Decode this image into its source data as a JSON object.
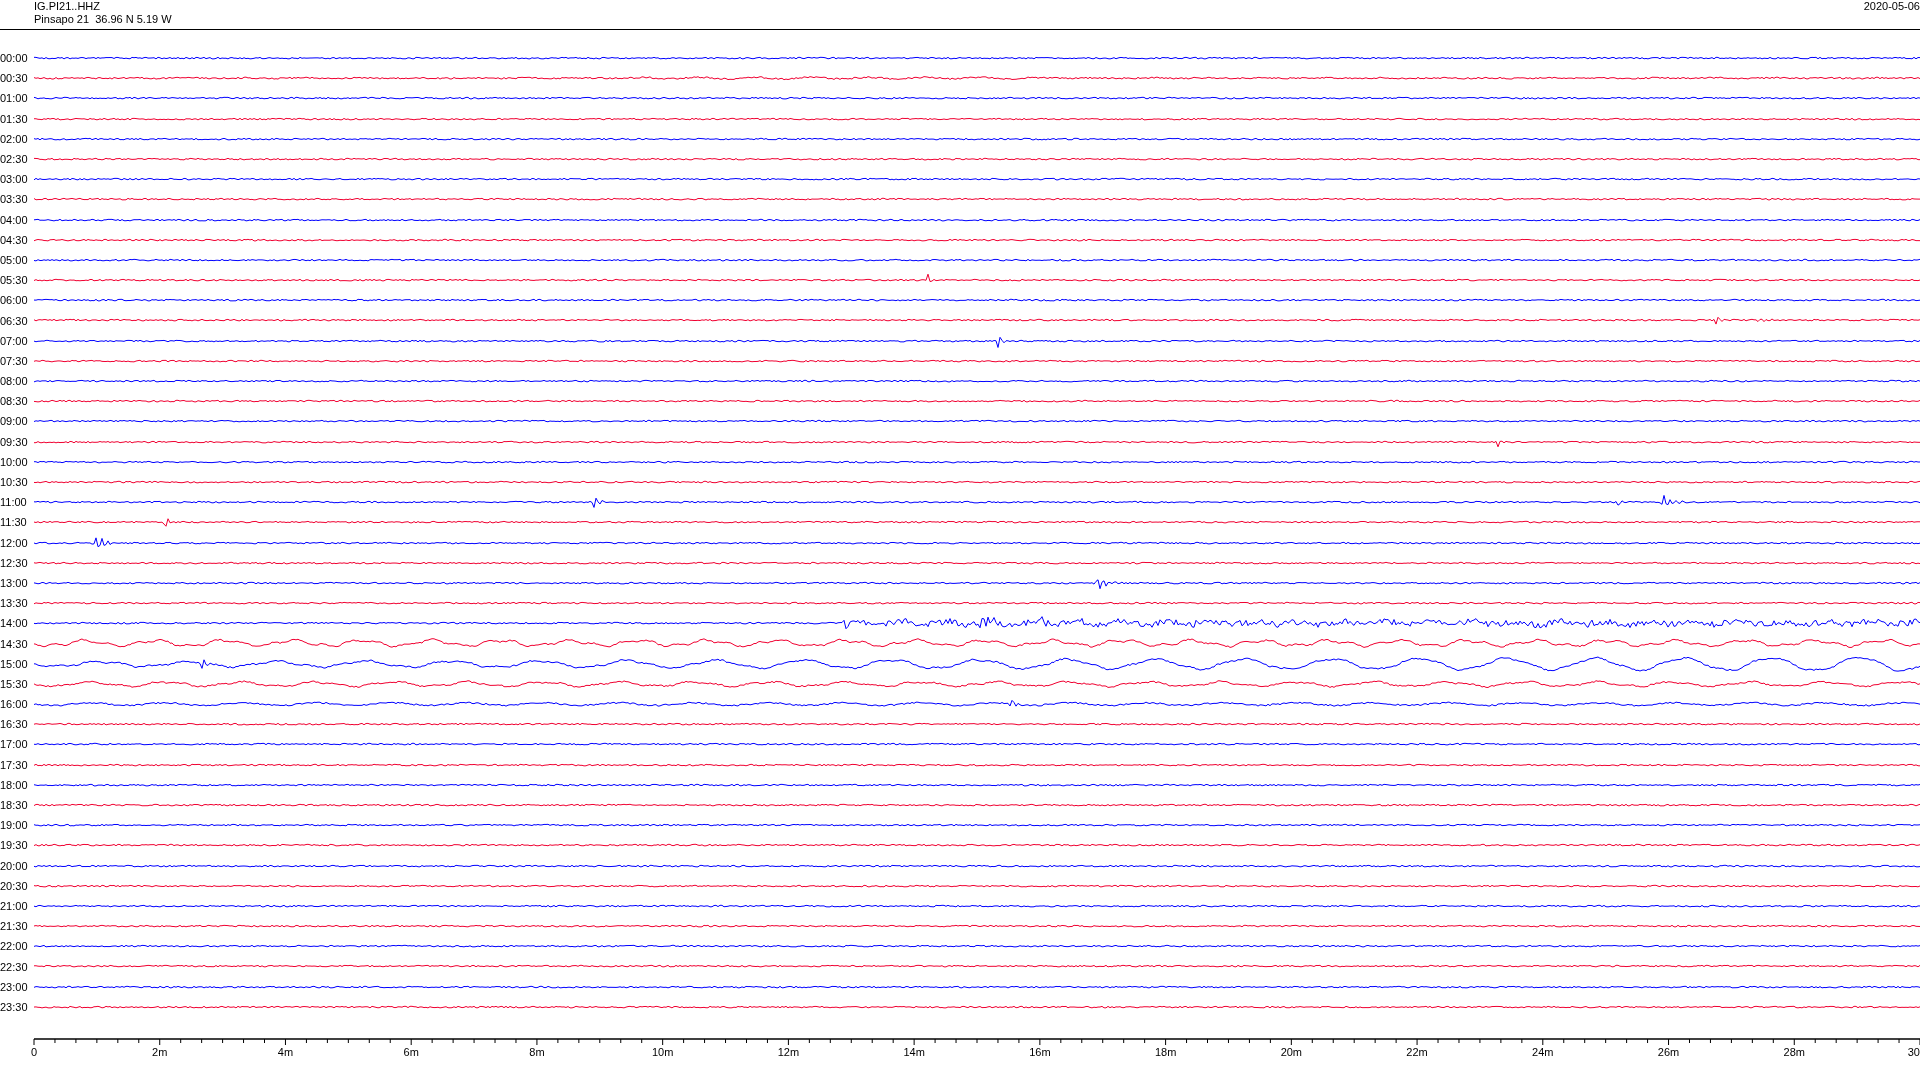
{
  "header": {
    "station": "IG.PI21..HHZ",
    "location": "Pinsapo 21  36.96 N 5.19 W",
    "date": "2020-05-06"
  },
  "traces": [
    {
      "time": "00:00",
      "color": "#0000ff"
    },
    {
      "time": "00:30",
      "color": "#f00030"
    },
    {
      "time": "01:00",
      "color": "#0000ff"
    },
    {
      "time": "01:30",
      "color": "#f00030"
    },
    {
      "time": "02:00",
      "color": "#0000ff"
    },
    {
      "time": "02:30",
      "color": "#f00030"
    },
    {
      "time": "03:00",
      "color": "#0000ff"
    },
    {
      "time": "03:30",
      "color": "#f00030"
    },
    {
      "time": "04:00",
      "color": "#0000ff"
    },
    {
      "time": "04:30",
      "color": "#f00030"
    },
    {
      "time": "05:00",
      "color": "#0000ff"
    },
    {
      "time": "05:30",
      "color": "#f00030"
    },
    {
      "time": "06:00",
      "color": "#0000ff"
    },
    {
      "time": "06:30",
      "color": "#f00030"
    },
    {
      "time": "07:00",
      "color": "#0000ff"
    },
    {
      "time": "07:30",
      "color": "#f00030"
    },
    {
      "time": "08:00",
      "color": "#0000ff"
    },
    {
      "time": "08:30",
      "color": "#f00030"
    },
    {
      "time": "09:00",
      "color": "#0000ff"
    },
    {
      "time": "09:30",
      "color": "#f00030"
    },
    {
      "time": "10:00",
      "color": "#0000ff"
    },
    {
      "time": "10:30",
      "color": "#f00030"
    },
    {
      "time": "11:00",
      "color": "#0000ff"
    },
    {
      "time": "11:30",
      "color": "#f00030"
    },
    {
      "time": "12:00",
      "color": "#0000ff"
    },
    {
      "time": "12:30",
      "color": "#f00030"
    },
    {
      "time": "13:00",
      "color": "#0000ff"
    },
    {
      "time": "13:30",
      "color": "#f00030"
    },
    {
      "time": "14:00",
      "color": "#0000ff"
    },
    {
      "time": "14:30",
      "color": "#f00030"
    },
    {
      "time": "15:00",
      "color": "#0000ff"
    },
    {
      "time": "15:30",
      "color": "#f00030"
    },
    {
      "time": "16:00",
      "color": "#0000ff"
    },
    {
      "time": "16:30",
      "color": "#f00030"
    },
    {
      "time": "17:00",
      "color": "#0000ff"
    },
    {
      "time": "17:30",
      "color": "#f00030"
    },
    {
      "time": "18:00",
      "color": "#0000ff"
    },
    {
      "time": "18:30",
      "color": "#f00030"
    },
    {
      "time": "19:00",
      "color": "#0000ff"
    },
    {
      "time": "19:30",
      "color": "#f00030"
    },
    {
      "time": "20:00",
      "color": "#0000ff"
    },
    {
      "time": "20:30",
      "color": "#f00030"
    },
    {
      "time": "21:00",
      "color": "#0000ff"
    },
    {
      "time": "21:30",
      "color": "#f00030"
    },
    {
      "time": "22:00",
      "color": "#0000ff"
    },
    {
      "time": "22:30",
      "color": "#f00030"
    },
    {
      "time": "23:00",
      "color": "#0000ff"
    },
    {
      "time": "23:30",
      "color": "#f00030"
    }
  ],
  "axis": {
    "ticks": [
      "0",
      "2m",
      "4m",
      "6m",
      "8m",
      "10m",
      "12m",
      "14m",
      "16m",
      "18m",
      "20m",
      "22m",
      "24m",
      "26m",
      "28m",
      "30"
    ]
  }
}
